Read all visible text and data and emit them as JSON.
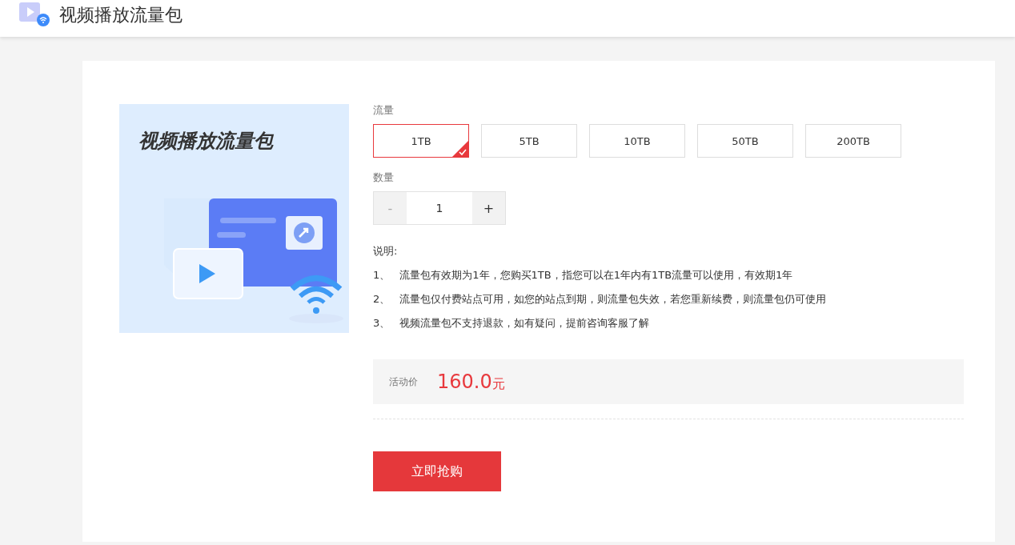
{
  "header": {
    "title": "视频播放流量包"
  },
  "product": {
    "image_title": "视频播放流量包"
  },
  "traffic": {
    "label": "流量",
    "options": [
      {
        "label": "1TB",
        "selected": true
      },
      {
        "label": "5TB",
        "selected": false
      },
      {
        "label": "10TB",
        "selected": false
      },
      {
        "label": "50TB",
        "selected": false
      },
      {
        "label": "200TB",
        "selected": false
      }
    ]
  },
  "quantity": {
    "label": "数量",
    "minus": "-",
    "value": "1",
    "plus": "+",
    "minus_disabled": true
  },
  "notes": {
    "title": "说明:",
    "items": [
      {
        "number": "1、",
        "text": "流量包有效期为1年，您购买1TB，指您可以在1年内有1TB流量可以使用，有效期1年"
      },
      {
        "number": "2、",
        "text": "流量包仅付费站点可用，如您的站点到期，则流量包失效，若您重新续费，则流量包仍可使用"
      },
      {
        "number": "3、",
        "text": "视频流量包不支持退款，如有疑问，提前咨询客服了解"
      }
    ]
  },
  "price": {
    "label": "活动价",
    "amount": "160.0",
    "unit": "元"
  },
  "buy_button": "立即抢购"
}
